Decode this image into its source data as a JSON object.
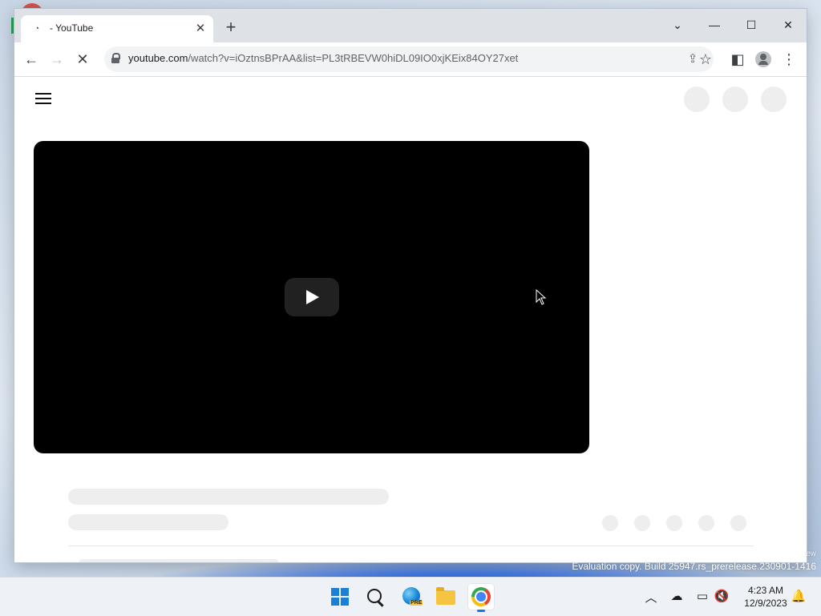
{
  "browser": {
    "tab": {
      "title": "- YouTube",
      "favicon": "loading-icon"
    },
    "new_tab_icon": "plus-icon",
    "window_controls": [
      "chevron-down-icon",
      "minimize-icon",
      "maximize-icon",
      "close-icon"
    ],
    "address_bar": {
      "url_host": "youtube.com",
      "url_path": "/watch?v=iOztnsBPrAA&list=PL3tRBEVW0hiDL09IO0xjKEix84OY27xet"
    },
    "toolbar_icons": [
      "back-icon",
      "forward-icon",
      "stop-loading-icon",
      "lock-icon",
      "share-icon",
      "star-icon",
      "side-panel-icon",
      "profile-icon",
      "more-icon"
    ]
  },
  "page": {
    "menu_icon": "hamburger-icon",
    "player": {
      "play_icon": "play-icon"
    }
  },
  "desktop": {
    "watermark_partial": "ew",
    "watermark": "Evaluation copy. Build 25947.rs_prerelease.230901-1416"
  },
  "taskbar": {
    "apps": [
      "start-icon",
      "search-icon",
      "edge-beta-icon",
      "file-explorer-icon",
      "chrome-icon"
    ],
    "edge_badge": "PRE",
    "tray_icons": [
      "chevron-up-icon",
      "onedrive-icon",
      "network-icon",
      "volume-muted-icon",
      "notification-bell-icon"
    ],
    "clock": {
      "time": "4:23 AM",
      "date": "12/9/2023"
    }
  },
  "colors": {
    "accent": "#1a73e8",
    "youtube_player_bg": "#000000",
    "skeleton": "#eeeeee",
    "titlebar": "#dee1e6"
  }
}
